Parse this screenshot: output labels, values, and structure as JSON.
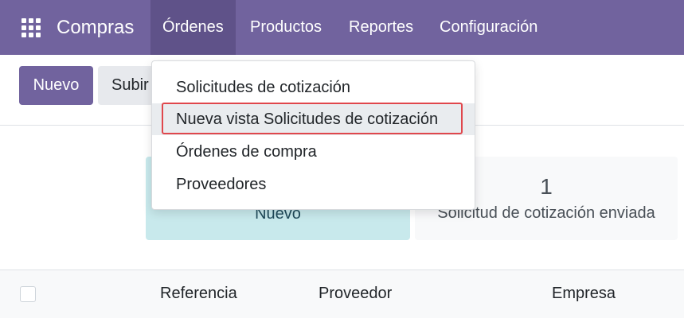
{
  "navbar": {
    "app_name": "Compras",
    "items": [
      {
        "label": "Órdenes"
      },
      {
        "label": "Productos"
      },
      {
        "label": "Reportes"
      },
      {
        "label": "Configuración"
      }
    ]
  },
  "control_panel": {
    "new_label": "Nuevo",
    "upload_label": "Subir"
  },
  "dropdown": {
    "items": [
      {
        "label": "Solicitudes de cotización"
      },
      {
        "label": "Nueva vista Solicitudes de cotización"
      },
      {
        "label": "Órdenes de compra"
      },
      {
        "label": "Proveedores"
      }
    ]
  },
  "dashboard": {
    "cards": [
      {
        "label": "Nuevo",
        "count": ""
      },
      {
        "label": "Solicitud de cotización enviada",
        "count": "1"
      }
    ]
  },
  "table": {
    "columns": [
      "Referencia",
      "Proveedor",
      "Empresa"
    ]
  },
  "colors": {
    "brand": "#71639e",
    "highlight": "#e0474c"
  }
}
